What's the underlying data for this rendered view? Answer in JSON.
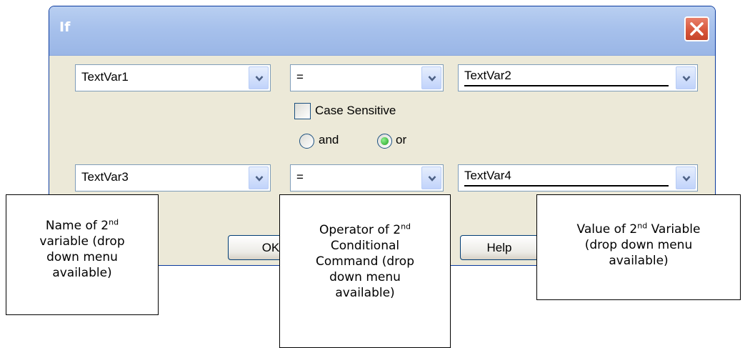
{
  "dialog": {
    "title": "If",
    "row1": {
      "variable": "TextVar1",
      "operator": "=",
      "value": "TextVar2"
    },
    "case_sensitive_label": "Case Sensitive",
    "case_sensitive_checked": false,
    "logic": {
      "and_label": "and",
      "or_label": "or",
      "selected": "or"
    },
    "row2": {
      "variable": "TextVar3",
      "operator": "=",
      "value": "TextVar4"
    },
    "buttons": {
      "ok_label": "OK",
      "help_label": "Help"
    }
  },
  "annotations": {
    "name": {
      "line1_prefix": "Name of 2",
      "line1_sup": "nd",
      "line2": "variable (drop",
      "line3": "down menu",
      "line4": "available)"
    },
    "operator": {
      "line1_prefix": "Operator of 2",
      "line1_sup": "nd",
      "line2": "Conditional",
      "line3": "Command (drop",
      "line4": "down menu",
      "line5": "available)"
    },
    "value": {
      "line1_prefix": "Value of 2",
      "line1_sup": "nd",
      "line1_suffix": " Variable",
      "line2": "(drop down menu",
      "line3": "available)"
    }
  },
  "colors": {
    "titlebar": "#a7c1ec",
    "dialog_bg": "#ece9d8",
    "close_button": "#d8573c",
    "radio_selected": "#21a121"
  },
  "icons": {
    "close": "close-x-icon",
    "dropdown": "chevron-down-icon"
  }
}
